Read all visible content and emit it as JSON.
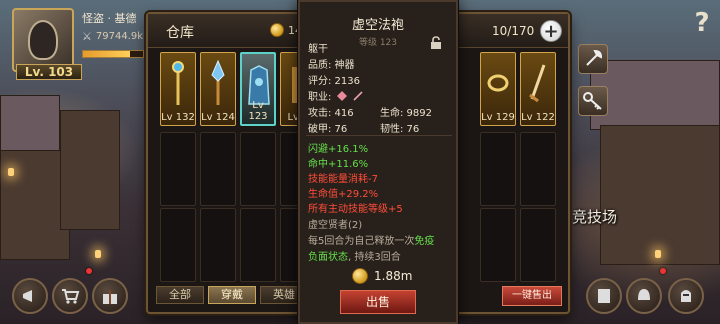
{
  "player": {
    "name": "怪盗 · 基德",
    "power": "79744.9k",
    "level": "Lv. 103",
    "xp_fraction": 0.78
  },
  "inventory": {
    "title": "仓库",
    "gold": "14",
    "capacity": "10/170",
    "add_label": "+",
    "items": [
      {
        "level": "Lv 132",
        "kind": "staff-gold"
      },
      {
        "level": "Lv 124",
        "kind": "staff-blue"
      },
      {
        "level": "Lv 123",
        "kind": "robe-blue"
      },
      {
        "level": "Lv 1",
        "kind": "misc"
      },
      {
        "level": "",
        "kind": "hidden"
      },
      {
        "level": "",
        "kind": "hidden"
      },
      {
        "level": "Lv 129",
        "kind": "ring"
      },
      {
        "level": "Lv 122",
        "kind": "sword"
      }
    ],
    "filters": [
      "全部",
      "穿戴",
      "英雄"
    ],
    "active_filter": "穿戴",
    "bulk_sell_label": "一键售出"
  },
  "tooltip": {
    "name": "虚空法袍",
    "sub_level": "等级 123",
    "lines": {
      "type": "躯干",
      "quality": "品质: 神器",
      "score": "评分: 2136",
      "class_label": "职业:",
      "attack": "攻击: 416",
      "hp": "生命: 9892",
      "armor_break": "破甲: 76",
      "toughness": "韧性: 76",
      "dodge": "闪避+16.1%",
      "hit": "命中+11.6%",
      "energy": "技能能量消耗-7",
      "hp_pct": "生命值+29.2%",
      "skill_lvl": "所有主动技能等级+5",
      "set_name": "虚空贤者(2)",
      "set_desc_1": "每5回合为自己释放一次",
      "set_desc_1_hl": "免疫",
      "set_desc_2_hl": "负面状态",
      "set_desc_2": ", 持续3回合"
    },
    "price": "1.88m",
    "sell_label": "出售"
  },
  "world": {
    "arena_label": "竞技场"
  },
  "help_label": "?",
  "colors": {
    "gold_border": "#c9a55a",
    "selected_border": "#5fd2c8",
    "stat_green": "#65e04c",
    "stat_red": "#ff4d3a",
    "set_orange": "#ff9c2a",
    "sell_red": "#c44232"
  }
}
